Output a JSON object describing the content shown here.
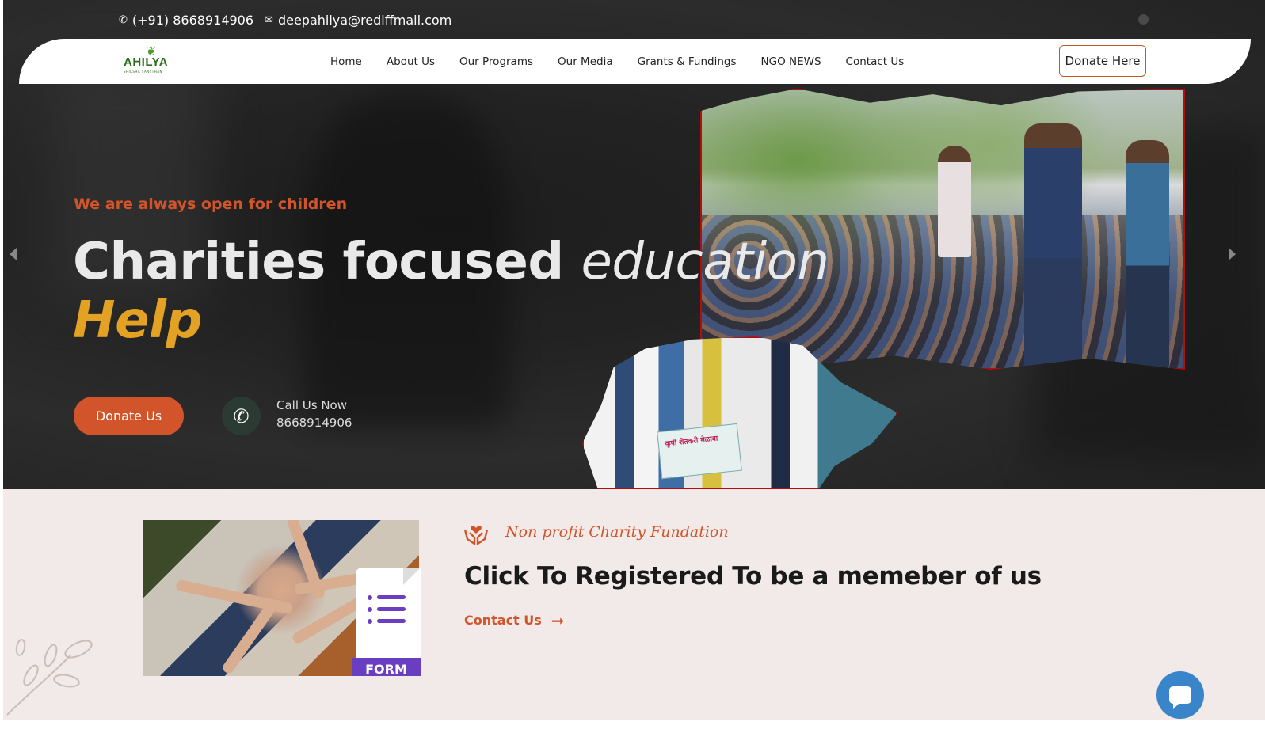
{
  "topbar": {
    "phone": "(+91) 8668914906",
    "email": "deepahilya@rediffmail.com",
    "phone_icon": "phone-icon",
    "email_icon": "mail-icon"
  },
  "logo": {
    "name": "AHILYA",
    "subtitle": "SHIKSHA SANSTHAN"
  },
  "nav": {
    "items": [
      "Home",
      "About Us",
      "Our Programs",
      "Our Media",
      "Grants & Fundings",
      "NGO NEWS",
      "Contact Us"
    ],
    "cta": "Donate Here"
  },
  "hero": {
    "tagline": "We are always open for children",
    "headline_plain": "Charities focused",
    "headline_italic": "education",
    "headline_accent": "Help",
    "donate_button": "Donate Us",
    "call_label": "Call Us Now",
    "call_number": "8668914906",
    "photo_banner_text": "कृषी शेतकरी मेळावा"
  },
  "lower": {
    "kicker": "Non profit Charity Fundation",
    "title": "Click To Registered To be a memeber of us",
    "link": "Contact Us",
    "form_tag": "FORM"
  },
  "colors": {
    "accent": "#d2542a",
    "gold": "#e4a224",
    "lower_bg": "#f1eae8",
    "chat": "#3a85c9"
  }
}
